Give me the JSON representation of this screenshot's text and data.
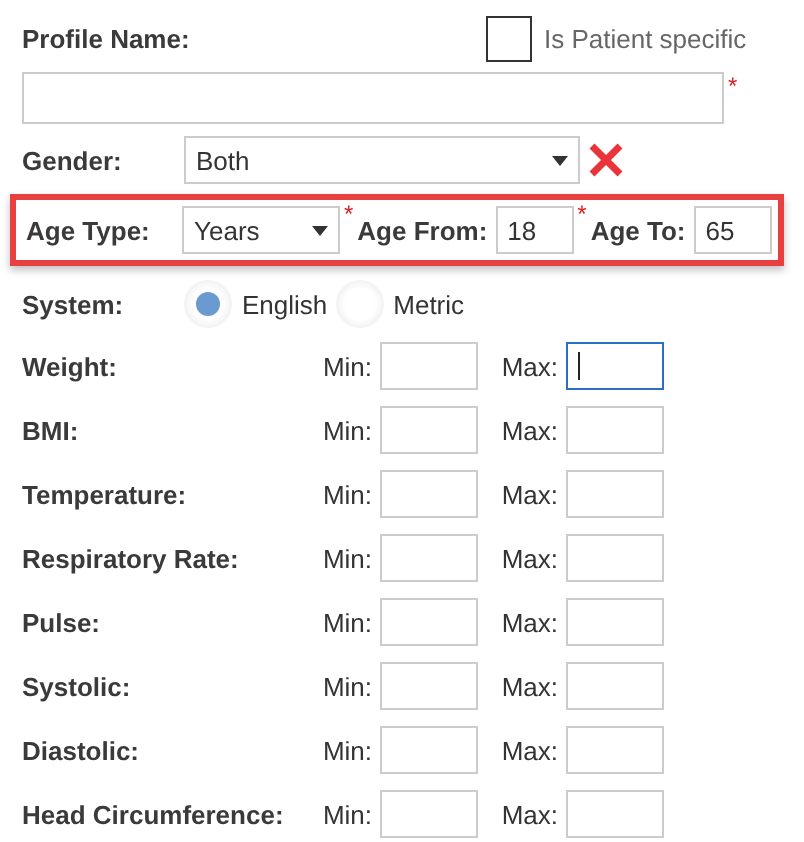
{
  "profile": {
    "label": "Profile Name:",
    "patient_specific": {
      "label": "Is Patient specific",
      "checked": false
    },
    "required_mark": "*"
  },
  "gender": {
    "label": "Gender:",
    "value": "Both"
  },
  "age": {
    "type_label": "Age Type:",
    "type_value": "Years",
    "from_required_mark": "*",
    "from_label": "Age From:",
    "from_value": "18",
    "to_required_mark": "*",
    "to_label": "Age To:",
    "to_value": "65",
    "highlighted": true
  },
  "system": {
    "label": "System:",
    "options": [
      {
        "label": "English",
        "selected": true
      },
      {
        "label": "Metric",
        "selected": false
      }
    ]
  },
  "measurements": [
    {
      "label": "Weight:",
      "min_label": "Min:",
      "max_label": "Max:",
      "max_focused": true
    },
    {
      "label": "BMI:",
      "min_label": "Min:",
      "max_label": "Max:",
      "max_focused": false
    },
    {
      "label": "Temperature:",
      "min_label": "Min:",
      "max_label": "Max:",
      "max_focused": false
    },
    {
      "label": "Respiratory Rate:",
      "min_label": "Min:",
      "max_label": "Max:",
      "max_focused": false
    },
    {
      "label": "Pulse:",
      "min_label": "Min:",
      "max_label": "Max:",
      "max_focused": false
    },
    {
      "label": "Systolic:",
      "min_label": "Min:",
      "max_label": "Max:",
      "max_focused": false
    },
    {
      "label": "Diastolic:",
      "min_label": "Min:",
      "max_label": "Max:",
      "max_focused": false
    },
    {
      "label": "Head Circumference:",
      "min_label": "Min:",
      "max_label": "Max:",
      "max_focused": false
    }
  ]
}
